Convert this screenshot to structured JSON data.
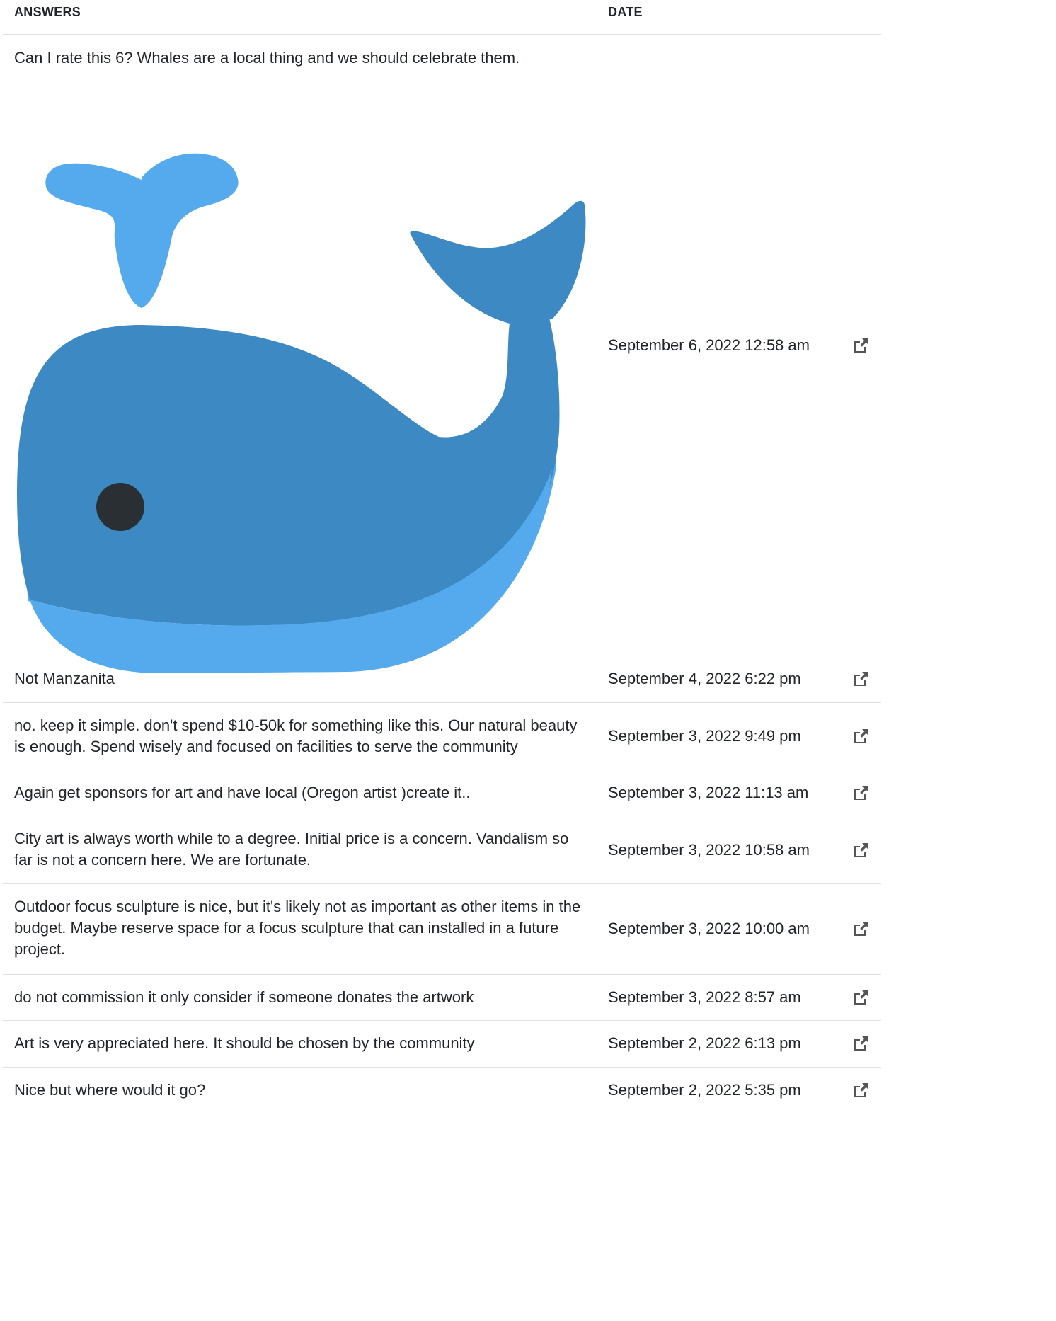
{
  "table": {
    "headers": {
      "answers": "ANSWERS",
      "date": "DATE"
    },
    "rows": [
      {
        "answer": "Can I rate this 6? Whales are a local thing and we should celebrate them.",
        "date": "September 6, 2022 12:58 am",
        "image_icon": "whale-icon",
        "link_icon": "external-link-icon"
      },
      {
        "answer": "Not Manzanita",
        "date": "September 4, 2022 6:22 pm",
        "link_icon": "external-link-icon"
      },
      {
        "answer": "no. keep it simple. don't spend $10-50k for something like this. Our natural beauty is enough. Spend wisely and focused on facilities to serve the community",
        "date": "September 3, 2022 9:49 pm",
        "link_icon": "external-link-icon"
      },
      {
        "answer": "Again get sponsors for art and have local (Oregon artist )create it..",
        "date": "September 3, 2022 11:13 am",
        "link_icon": "external-link-icon"
      },
      {
        "answer": "City art is always worth while to a degree. Initial price is a concern. Vandalism so far is not a concern here. We are fortunate.",
        "date": "September 3, 2022 10:58 am",
        "link_icon": "external-link-icon"
      },
      {
        "answer": "Outdoor focus sculpture is nice, but it's likely not as important as other items in the budget. Maybe reserve space for a focus sculpture that can installed in a future project.",
        "date": "September 3, 2022 10:00 am",
        "link_icon": "external-link-icon"
      },
      {
        "answer": "do not commission it only consider if someone donates the artwork",
        "date": "September 3, 2022 8:57 am",
        "link_icon": "external-link-icon"
      },
      {
        "answer": "Art is very appreciated here. It should be chosen by the community",
        "date": "September 2, 2022 6:13 pm",
        "link_icon": "external-link-icon"
      },
      {
        "answer": "Nice but where would it go?",
        "date": "September 2, 2022 5:35 pm",
        "link_icon": "external-link-icon"
      }
    ]
  },
  "colors": {
    "whale_dark": "#3d89c3",
    "whale_light": "#55aaee",
    "whale_eye": "#292f33",
    "border": "#dee2e6",
    "text": "#212529"
  }
}
